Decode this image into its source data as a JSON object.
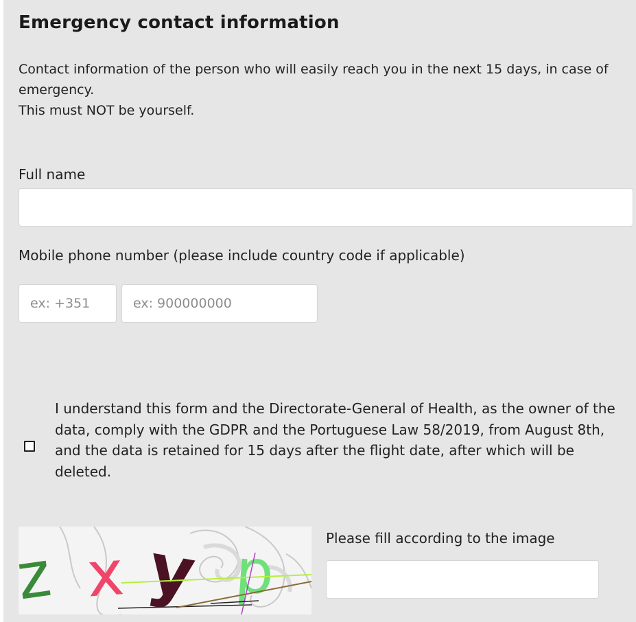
{
  "section": {
    "title": "Emergency contact information",
    "description_line1": "Contact information of the person who will easily reach you in the next 15 days, in case of emergency.",
    "description_line2": "This must NOT be yourself."
  },
  "full_name": {
    "label": "Full name",
    "value": "",
    "placeholder": ""
  },
  "mobile_phone": {
    "label": "Mobile phone number (please include country code if applicable)",
    "country_code_placeholder": "ex: +351",
    "number_placeholder": "ex: 900000000",
    "country_code_value": "",
    "number_value": ""
  },
  "consent": {
    "checked": false,
    "text": "I understand this form and the Directorate-General of Health, as the owner of the data, comply with the GDPR and the Portuguese Law 58/2019, from August 8th, and the data is retained for 15 days after the flight date, after which will be deleted."
  },
  "captcha": {
    "characters": [
      "z",
      "x",
      "y",
      "p"
    ],
    "character_colors": [
      "#3a8a3a",
      "#f0456a",
      "#4a1222",
      "#6fe07a"
    ],
    "label": "Please fill according to the image",
    "value": ""
  },
  "colors": {
    "panel_background": "#e6e6e6",
    "input_background": "#ffffff",
    "input_border": "#d6d6d6",
    "text": "#222222"
  }
}
